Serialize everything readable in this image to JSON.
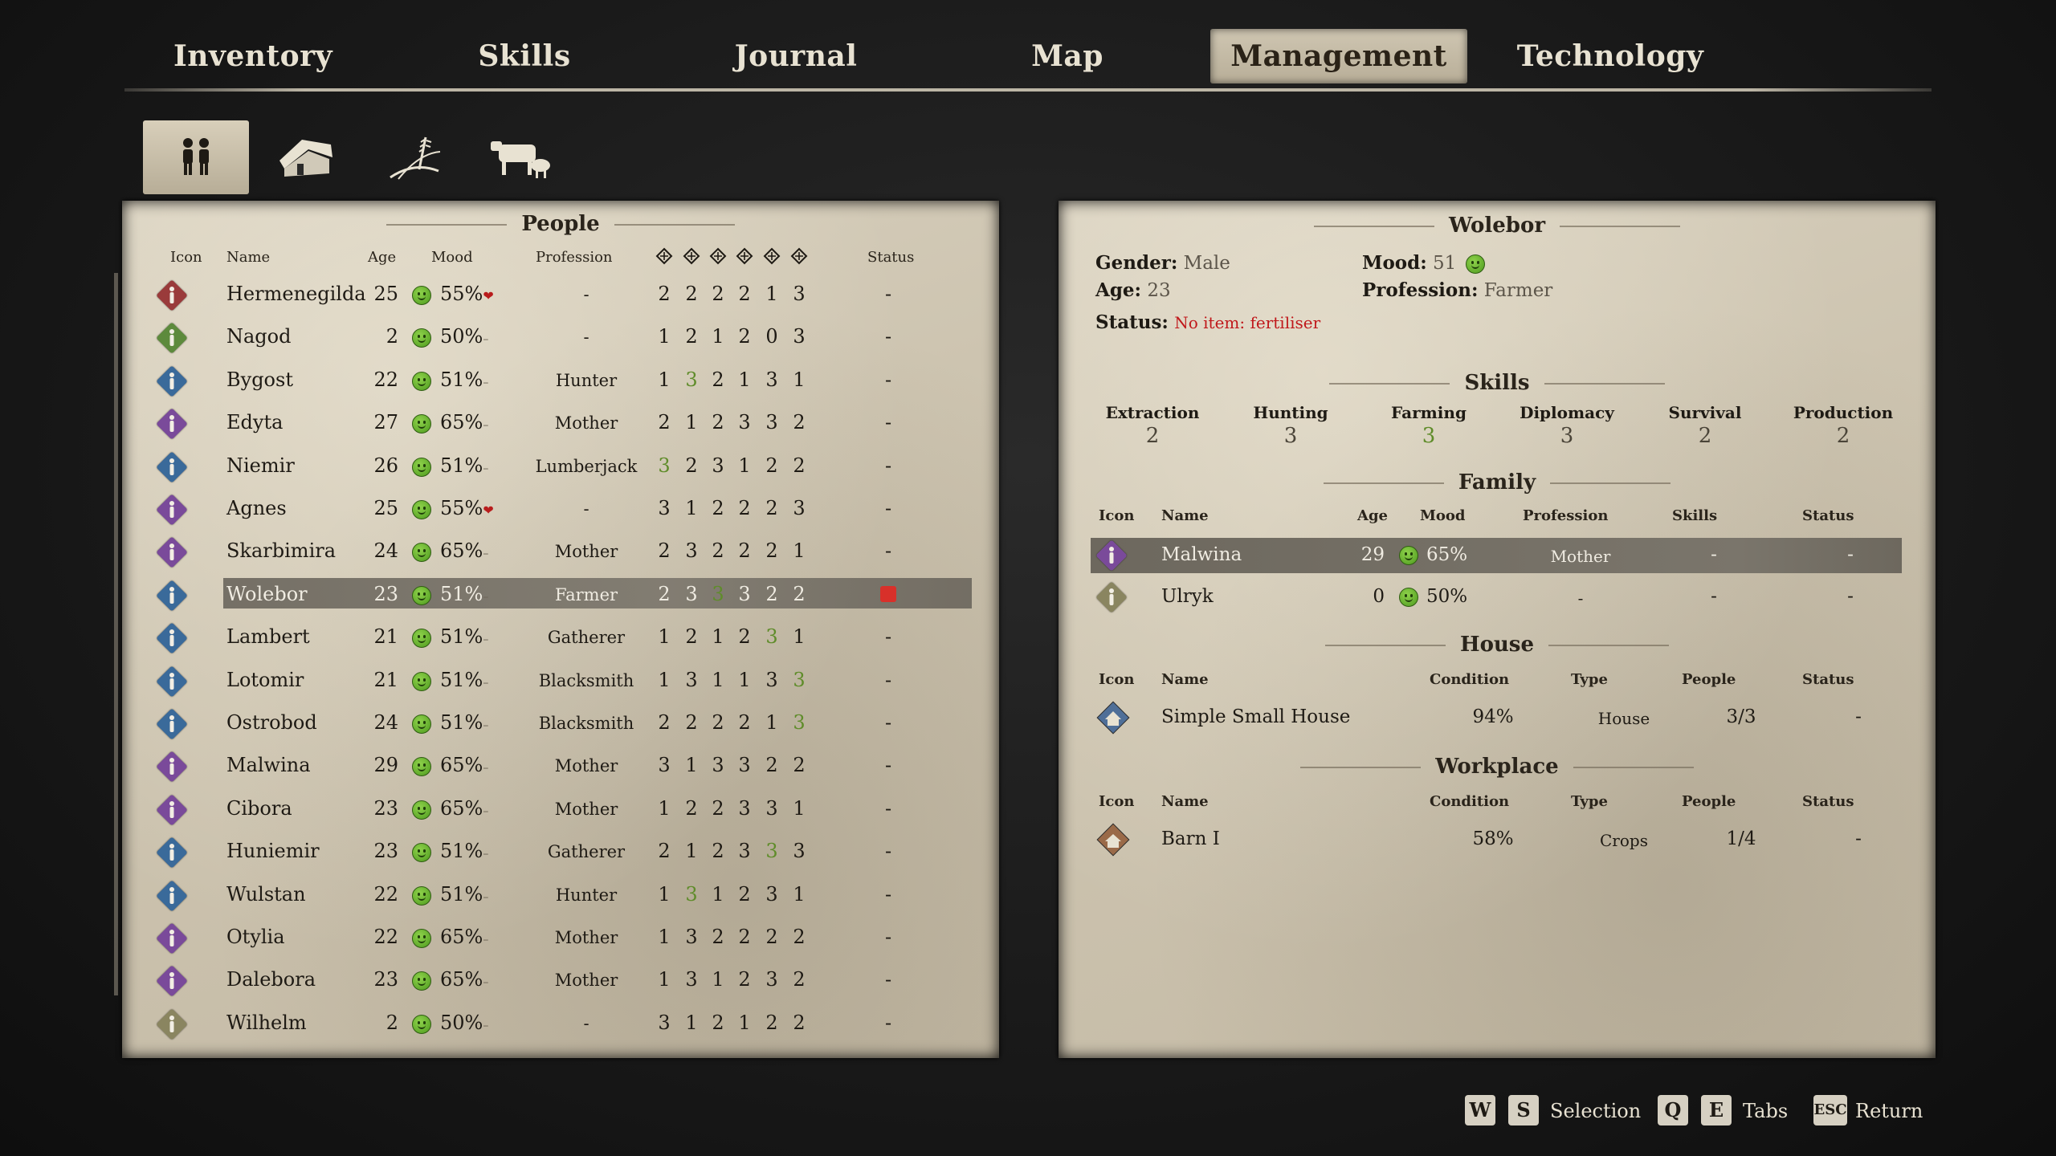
{
  "top_tabs": [
    {
      "label": "Inventory"
    },
    {
      "label": "Skills"
    },
    {
      "label": "Journal"
    },
    {
      "label": "Map"
    },
    {
      "label": "Management"
    },
    {
      "label": "Technology"
    }
  ],
  "active_top_tab": "Management",
  "sub_tabs": [
    {
      "icon": "people-icon"
    },
    {
      "icon": "house-icon"
    },
    {
      "icon": "wheat-field-icon"
    },
    {
      "icon": "livestock-icon"
    }
  ],
  "people": {
    "title": "People",
    "headers": {
      "icon": "Icon",
      "name": "Name",
      "age": "Age",
      "mood": "Mood",
      "profession": "Profession",
      "status": "Status"
    },
    "skill_header_icons": [
      "extraction-icon",
      "hunting-icon",
      "farming-icon",
      "diplomacy-icon",
      "survival-icon",
      "production-icon"
    ],
    "rows": [
      {
        "name": "Hermenegilda",
        "age": "25",
        "mood": "55%",
        "trend": "down",
        "profession": "-",
        "skills": [
          "2",
          "2",
          "2",
          "2",
          "1",
          "3"
        ],
        "hi": [],
        "status": "-",
        "color": "#9a3b3b"
      },
      {
        "name": "Nagod",
        "age": "2",
        "mood": "50%",
        "trend": "flat",
        "profession": "-",
        "skills": [
          "1",
          "2",
          "1",
          "2",
          "0",
          "3"
        ],
        "hi": [],
        "status": "-",
        "color": "#5d8a3c"
      },
      {
        "name": "Bygost",
        "age": "22",
        "mood": "51%",
        "trend": "flat",
        "profession": "Hunter",
        "skills": [
          "1",
          "3",
          "2",
          "1",
          "3",
          "1"
        ],
        "hi": [
          1
        ],
        "status": "-",
        "color": "#3a6a9a"
      },
      {
        "name": "Edyta",
        "age": "27",
        "mood": "65%",
        "trend": "flat",
        "profession": "Mother",
        "skills": [
          "2",
          "1",
          "2",
          "3",
          "3",
          "2"
        ],
        "hi": [],
        "status": "-",
        "color": "#7a4a9a"
      },
      {
        "name": "Niemir",
        "age": "26",
        "mood": "51%",
        "trend": "flat",
        "profession": "Lumberjack",
        "skills": [
          "3",
          "2",
          "3",
          "1",
          "2",
          "2"
        ],
        "hi": [
          0
        ],
        "status": "-",
        "color": "#3a6a9a"
      },
      {
        "name": "Agnes",
        "age": "25",
        "mood": "55%",
        "trend": "down",
        "profession": "-",
        "skills": [
          "3",
          "1",
          "2",
          "2",
          "2",
          "3"
        ],
        "hi": [],
        "status": "-",
        "color": "#7a4a9a"
      },
      {
        "name": "Skarbimira",
        "age": "24",
        "mood": "65%",
        "trend": "flat",
        "profession": "Mother",
        "skills": [
          "2",
          "3",
          "2",
          "2",
          "2",
          "1"
        ],
        "hi": [],
        "status": "-",
        "color": "#7a4a9a"
      },
      {
        "name": "Wolebor",
        "age": "23",
        "mood": "51%",
        "trend": "flat",
        "profession": "Farmer",
        "skills": [
          "2",
          "3",
          "3",
          "3",
          "2",
          "2"
        ],
        "hi": [
          2
        ],
        "status": "",
        "color": "#3a6a9a",
        "selected": true
      },
      {
        "name": "Lambert",
        "age": "21",
        "mood": "51%",
        "trend": "flat",
        "profession": "Gatherer",
        "skills": [
          "1",
          "2",
          "1",
          "2",
          "3",
          "1"
        ],
        "hi": [
          4
        ],
        "status": "-",
        "color": "#3a6a9a"
      },
      {
        "name": "Lotomir",
        "age": "21",
        "mood": "51%",
        "trend": "flat",
        "profession": "Blacksmith",
        "skills": [
          "1",
          "3",
          "1",
          "1",
          "3",
          "3"
        ],
        "hi": [
          5
        ],
        "status": "-",
        "color": "#3a6a9a"
      },
      {
        "name": "Ostrobod",
        "age": "24",
        "mood": "51%",
        "trend": "flat",
        "profession": "Blacksmith",
        "skills": [
          "2",
          "2",
          "2",
          "2",
          "1",
          "3"
        ],
        "hi": [
          5
        ],
        "status": "-",
        "color": "#3a6a9a"
      },
      {
        "name": "Malwina",
        "age": "29",
        "mood": "65%",
        "trend": "flat",
        "profession": "Mother",
        "skills": [
          "3",
          "1",
          "3",
          "3",
          "2",
          "2"
        ],
        "hi": [],
        "status": "-",
        "color": "#7a4a9a"
      },
      {
        "name": "Cibora",
        "age": "23",
        "mood": "65%",
        "trend": "flat",
        "profession": "Mother",
        "skills": [
          "1",
          "2",
          "2",
          "3",
          "3",
          "1"
        ],
        "hi": [],
        "status": "-",
        "color": "#7a4a9a"
      },
      {
        "name": "Huniemir",
        "age": "23",
        "mood": "51%",
        "trend": "flat",
        "profession": "Gatherer",
        "skills": [
          "2",
          "1",
          "2",
          "3",
          "3",
          "3"
        ],
        "hi": [
          4
        ],
        "status": "-",
        "color": "#3a6a9a"
      },
      {
        "name": "Wulstan",
        "age": "22",
        "mood": "51%",
        "trend": "flat",
        "profession": "Hunter",
        "skills": [
          "1",
          "3",
          "1",
          "2",
          "3",
          "1"
        ],
        "hi": [
          1
        ],
        "status": "-",
        "color": "#3a6a9a"
      },
      {
        "name": "Otylia",
        "age": "22",
        "mood": "65%",
        "trend": "flat",
        "profession": "Mother",
        "skills": [
          "1",
          "3",
          "2",
          "2",
          "2",
          "2"
        ],
        "hi": [],
        "status": "-",
        "color": "#7a4a9a"
      },
      {
        "name": "Dalebora",
        "age": "23",
        "mood": "65%",
        "trend": "flat",
        "profession": "Mother",
        "skills": [
          "1",
          "3",
          "1",
          "2",
          "3",
          "2"
        ],
        "hi": [],
        "status": "-",
        "color": "#7a4a9a"
      },
      {
        "name": "Wilhelm",
        "age": "2",
        "mood": "50%",
        "trend": "flat",
        "profession": "-",
        "skills": [
          "3",
          "1",
          "2",
          "1",
          "2",
          "2"
        ],
        "hi": [],
        "status": "-",
        "color": "#8a8560"
      }
    ]
  },
  "detail": {
    "title": "Wolebor",
    "gender_label": "Gender:",
    "gender": "Male",
    "age_label": "Age:",
    "age": "23",
    "mood_label": "Mood:",
    "mood": "51",
    "profession_label": "Profession:",
    "profession": "Farmer",
    "status_label": "Status:",
    "status": "No item: fertiliser",
    "skills_title": "Skills",
    "skills": [
      {
        "name": "Extraction",
        "value": "2"
      },
      {
        "name": "Hunting",
        "value": "3"
      },
      {
        "name": "Farming",
        "value": "3",
        "highlight": true
      },
      {
        "name": "Diplomacy",
        "value": "3"
      },
      {
        "name": "Survival",
        "value": "2"
      },
      {
        "name": "Production",
        "value": "2"
      }
    ],
    "family_title": "Family",
    "family_headers": {
      "icon": "Icon",
      "name": "Name",
      "age": "Age",
      "mood": "Mood",
      "profession": "Profession",
      "skills": "Skills",
      "status": "Status"
    },
    "family": [
      {
        "name": "Malwina",
        "age": "29",
        "mood": "65%",
        "profession": "Mother",
        "skills": "-",
        "status": "-",
        "color": "#7a4a9a",
        "selected": true
      },
      {
        "name": "Ulryk",
        "age": "0",
        "mood": "50%",
        "profession": "-",
        "skills": "-",
        "status": "-",
        "color": "#8a8560"
      }
    ],
    "house_title": "House",
    "house_headers": {
      "icon": "Icon",
      "name": "Name",
      "condition": "Condition",
      "type": "Type",
      "people": "People",
      "status": "Status"
    },
    "house": {
      "name": "Simple Small House",
      "condition": "94%",
      "type": "House",
      "people": "3/3",
      "status": "-"
    },
    "workplace_title": "Workplace",
    "workplace_headers": {
      "icon": "Icon",
      "name": "Name",
      "condition": "Condition",
      "type": "Type",
      "people": "People",
      "status": "Status"
    },
    "workplace": {
      "name": "Barn I",
      "condition": "58%",
      "type": "Crops",
      "people": "1/4",
      "status": "-"
    }
  },
  "footer": {
    "keys1": [
      "W",
      "S"
    ],
    "label1": "Selection",
    "keys2": [
      "Q",
      "E"
    ],
    "label2": "Tabs",
    "key3": "ESC",
    "label3": "Return"
  },
  "colors": {
    "highlight_green": "#5f8c2a",
    "error_red": "#c0181b",
    "parchment": "#cdc4b0"
  }
}
